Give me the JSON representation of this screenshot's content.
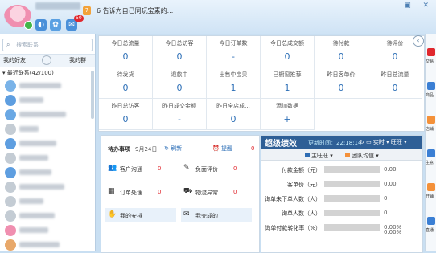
{
  "header": {
    "level_badge": "7",
    "signature": "6 告诉为自己同玩宝素的...",
    "mail_badge": "50",
    "window_controls": "▣ ✕"
  },
  "sidebar": {
    "search_placeholder": "搜索联系",
    "tabs": [
      "我的好友",
      "我的群"
    ],
    "contacts_group": "▾ 最近联系(42/100)",
    "contact_count": 11
  },
  "stats": {
    "row1": [
      {
        "label": "今日总流量",
        "value": "0"
      },
      {
        "label": "今日总访客",
        "value": "0"
      },
      {
        "label": "今日订单数",
        "value": "-"
      },
      {
        "label": "今日总成交额",
        "value": "0"
      },
      {
        "label": "待付款",
        "value": "0"
      },
      {
        "label": "待评价",
        "value": "0"
      }
    ],
    "row2": [
      {
        "label": "待发货",
        "value": "0"
      },
      {
        "label": "退款中",
        "value": "0"
      },
      {
        "label": "出售中宝贝",
        "value": "1"
      },
      {
        "label": "已橱窗推荐",
        "value": "1"
      },
      {
        "label": "昨日客单价",
        "value": "0"
      },
      {
        "label": "昨日总流量",
        "value": "0"
      }
    ],
    "row3": [
      {
        "label": "昨日总访客",
        "value": "0"
      },
      {
        "label": "昨日成交金额",
        "value": "-"
      },
      {
        "label": "昨日全店成...",
        "value": "0"
      },
      {
        "label": "添加数据",
        "value": "+"
      }
    ]
  },
  "todo": {
    "title": "待办事项",
    "date": "9月24日",
    "refresh": "刷新",
    "remind": "提醒",
    "remind_count": "0",
    "items": [
      "客户沟通",
      "负面评价",
      "订单处理",
      "物流异常",
      "我的安排",
      "我完成的"
    ],
    "counts": [
      "0",
      "0",
      "0",
      "0",
      "",
      ""
    ]
  },
  "performance": {
    "title": "超级绩效",
    "update_time": "更新时间：22:18:14",
    "controls": "↻  ▭  实时 ▾  旺旺 ▾",
    "legend": [
      "主旺旺 ▾",
      "团队均值 ▾"
    ],
    "rows": [
      {
        "label": "付款金额（元）",
        "value": "0.00"
      },
      {
        "label": "客单价（元）",
        "value": "0.00"
      },
      {
        "label": "询单未下单人数（人）",
        "value": "0"
      },
      {
        "label": "询单人数（人）",
        "value": "0"
      },
      {
        "label": "询单付款转化率（%）",
        "value": "0.00%"
      }
    ],
    "extra": "0.00%"
  },
  "right_strip": [
    "交易",
    "商品",
    "店铺",
    "生意",
    "旺铺",
    "直通"
  ],
  "colors": {
    "accent": "#2e5f96",
    "value_blue": "#2d6fb7",
    "legend_blue": "#2e6db4",
    "legend_orange": "#f4913a"
  }
}
